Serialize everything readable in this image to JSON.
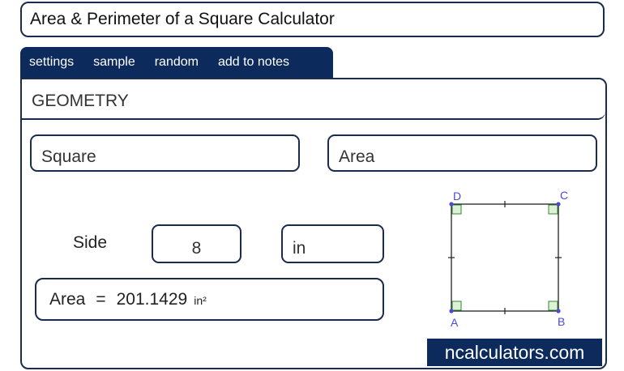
{
  "title": "Area & Perimeter of a Square Calculator",
  "tabs": [
    {
      "label": "settings"
    },
    {
      "label": "sample"
    },
    {
      "label": "random"
    },
    {
      "label": "add to notes"
    }
  ],
  "section": "GEOMETRY",
  "shape_select": "Square",
  "calc_select": "Area",
  "input": {
    "label": "Side",
    "value": "8",
    "unit": "in"
  },
  "result": {
    "label": "Area",
    "equals": "=",
    "value": "201.1429",
    "unit": "in²"
  },
  "diagram": {
    "vertices": {
      "a": "A",
      "b": "B",
      "c": "C",
      "d": "D"
    },
    "line_color": "#222222",
    "point_color": "#4a4ad6",
    "marker_color": "#2e8b2e"
  },
  "brand": "ncalculators.com",
  "colors": {
    "navy": "#0d2a5c",
    "border": "#1a2b4c"
  }
}
